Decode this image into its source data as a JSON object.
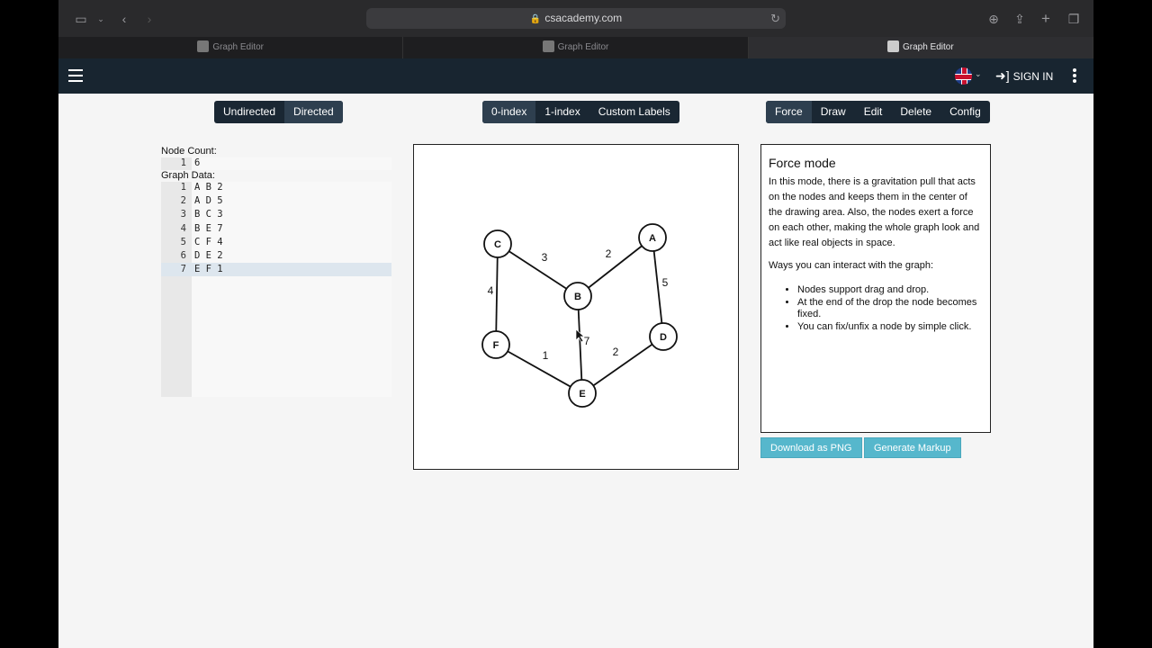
{
  "browser": {
    "url": "csacademy.com",
    "tabs": [
      {
        "label": "Graph Editor",
        "active": false
      },
      {
        "label": "Graph Editor",
        "active": false
      },
      {
        "label": "Graph Editor",
        "active": true
      }
    ]
  },
  "nav": {
    "sign_in": "SIGN IN"
  },
  "direction_group": {
    "items": [
      "Undirected",
      "Directed"
    ],
    "selected": 1
  },
  "index_group": {
    "items": [
      "0-index",
      "1-index",
      "Custom Labels"
    ],
    "selected": 0
  },
  "mode_group": {
    "items": [
      "Force",
      "Draw",
      "Edit",
      "Delete",
      "Config"
    ],
    "selected": 0
  },
  "editor": {
    "node_count_label": "Node Count:",
    "node_count_lines": [
      "6"
    ],
    "graph_data_label": "Graph Data:",
    "graph_data_lines": [
      "A B 2",
      "A D 5",
      "B C 3",
      "B E 7",
      "C F 4",
      "D E 2",
      "E F 1"
    ]
  },
  "graph": {
    "nodes": [
      {
        "label": "C"
      },
      {
        "label": "A"
      },
      {
        "label": "B"
      },
      {
        "label": "F"
      },
      {
        "label": "D"
      },
      {
        "label": "E"
      }
    ],
    "edges": [
      {
        "from": "A",
        "to": "B",
        "weight": "2"
      },
      {
        "from": "A",
        "to": "D",
        "weight": "5"
      },
      {
        "from": "B",
        "to": "C",
        "weight": "3"
      },
      {
        "from": "B",
        "to": "E",
        "weight": "7"
      },
      {
        "from": "C",
        "to": "F",
        "weight": "4"
      },
      {
        "from": "D",
        "to": "E",
        "weight": "2"
      },
      {
        "from": "E",
        "to": "F",
        "weight": "1"
      }
    ]
  },
  "panel": {
    "title": "Force mode",
    "paragraph1": "In this mode, there is a gravitation pull that acts on the nodes and keeps them in the center of the drawing area. Also, the nodes exert a force on each other, making the whole graph look and act like real objects in space.",
    "paragraph2": "Ways you can interact with the graph:",
    "bullets": [
      "Nodes support drag and drop.",
      "At the end of the drop the node becomes fixed.",
      "You can fix/unfix a node by simple click."
    ]
  },
  "actions": {
    "download": "Download as PNG",
    "markup": "Generate Markup"
  },
  "colors": {
    "nav_bg": "#182530",
    "action_bg": "#56b7cc"
  }
}
